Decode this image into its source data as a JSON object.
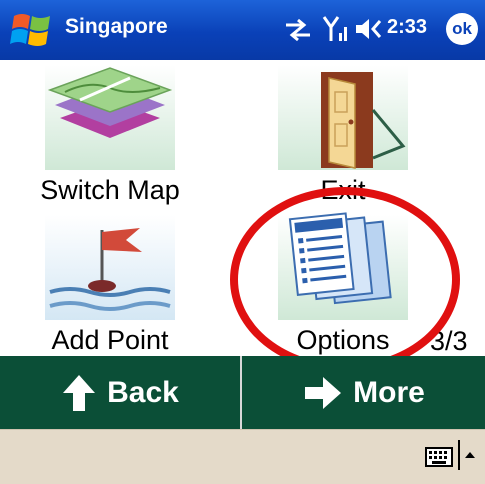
{
  "title_bar": {
    "app_title": "Singapore",
    "clock": "2:33",
    "ok_label": "ok"
  },
  "tiles": [
    {
      "label": "Switch Map",
      "icon": "map-icon"
    },
    {
      "label": "Exit",
      "icon": "door-icon"
    },
    {
      "label": "Add Point",
      "icon": "flag-icon"
    },
    {
      "label": "Options",
      "icon": "documents-icon"
    }
  ],
  "page_indicator": "3/3",
  "nav": {
    "back_label": "Back",
    "more_label": "More"
  },
  "colors": {
    "title_bar": "#0a41b8",
    "nav_bar": "#0b4f37",
    "bottom_bar": "#e4dac9",
    "annotation": "#e01010"
  }
}
